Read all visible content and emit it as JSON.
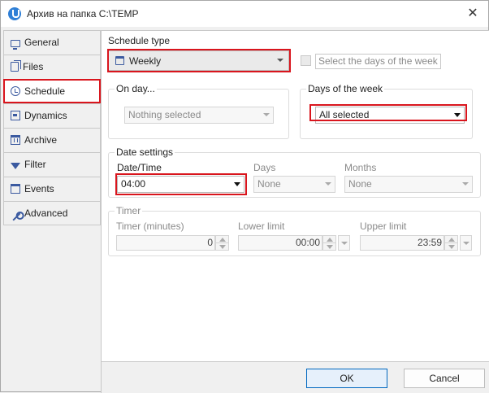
{
  "window": {
    "title": "Архив на папка C:\\TEMP",
    "close_symbol": "✕"
  },
  "sidebar": {
    "tabs": [
      {
        "label": "General",
        "icon": "monitor-icon"
      },
      {
        "label": "Files",
        "icon": "files-icon"
      },
      {
        "label": "Schedule",
        "icon": "alarm-clock-icon",
        "active": true
      },
      {
        "label": "Dynamics",
        "icon": "dynamics-icon"
      },
      {
        "label": "Archive",
        "icon": "archive-icon"
      },
      {
        "label": "Filter",
        "icon": "filter-icon"
      },
      {
        "label": "Events",
        "icon": "calendar-icon"
      },
      {
        "label": "Advanced",
        "icon": "wrench-icon"
      }
    ]
  },
  "schedule": {
    "type_label": "Schedule type",
    "type_value": "Weekly",
    "select_days_label": "Select the days of the week"
  },
  "on_day": {
    "title": "On day...",
    "value": "Nothing selected"
  },
  "days_of_week": {
    "title": "Days of the week",
    "value": "All selected"
  },
  "date_settings": {
    "title": "Date settings",
    "datetime_label": "Date/Time",
    "datetime_value": "04:00",
    "days_label": "Days",
    "days_value": "None",
    "months_label": "Months",
    "months_value": "None"
  },
  "timer": {
    "title": "Timer",
    "minutes_label": "Timer (minutes)",
    "minutes_value": "0",
    "lower_label": "Lower limit",
    "lower_value": "00:00",
    "upper_label": "Upper limit",
    "upper_value": "23:59"
  },
  "buttons": {
    "ok": "OK",
    "cancel": "Cancel"
  },
  "colors": {
    "highlight": "#d9151d",
    "icon_blue": "#3b5aa0",
    "ok_border": "#0067c0"
  }
}
